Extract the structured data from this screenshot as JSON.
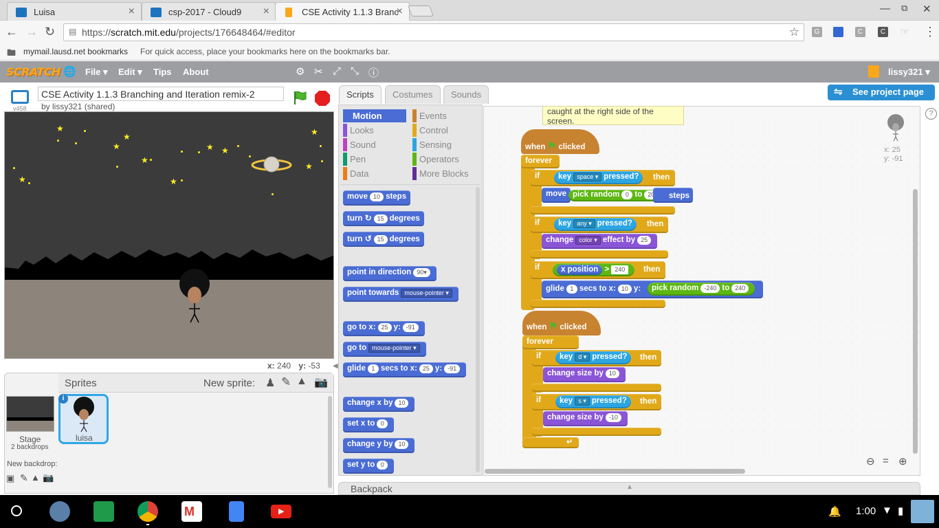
{
  "browser": {
    "tabs": [
      {
        "title": "Luisa",
        "close": "×"
      },
      {
        "title": "csp-2017 - Cloud9",
        "close": "×"
      },
      {
        "title": "CSE Activity 1.1.3 Branc",
        "close": "×"
      }
    ],
    "url_scheme": "https://",
    "url_host": "scratch.mit.edu",
    "url_path": "/projects/176648464/#editor",
    "bookmarks_folder": "mymail.lausd.net bookmarks",
    "bookmarks_hint": "For quick access, place your bookmarks here on the bookmarks bar.",
    "extensions": [
      "G",
      "C",
      "C"
    ]
  },
  "scratch_menu": {
    "logo": "SCRATCH",
    "file": "File ▾",
    "edit": "Edit ▾",
    "tips": "Tips",
    "about": "About",
    "user": "lissy321 ▾"
  },
  "project": {
    "title": "CSE Activity 1.1.3 Branching and Iteration remix-2",
    "byline": "by lissy321 (shared)",
    "version": "v458"
  },
  "stage": {
    "mouse_x_label": "x:",
    "mouse_x": "240",
    "mouse_y_label": "y:",
    "mouse_y": "-53"
  },
  "sprites": {
    "header": "Sprites",
    "new_sprite": "New sprite:",
    "stage_label": "Stage",
    "stage_backdrops": "2 backdrops",
    "new_backdrop": "New backdrop:",
    "sprite_name": "luisa",
    "info_icon": "i"
  },
  "editor_tabs": {
    "scripts": "Scripts",
    "costumes": "Costumes",
    "sounds": "Sounds"
  },
  "see_project": "See project page",
  "categories": [
    {
      "label": "Motion",
      "color": "#4a6cd4"
    },
    {
      "label": "Events",
      "color": "#c88330"
    },
    {
      "label": "Looks",
      "color": "#8a55d7"
    },
    {
      "label": "Control",
      "color": "#e1a91a"
    },
    {
      "label": "Sound",
      "color": "#bb42c3"
    },
    {
      "label": "Sensing",
      "color": "#2ca5e2"
    },
    {
      "label": "Pen",
      "color": "#0e9a6c"
    },
    {
      "label": "Operators",
      "color": "#5cb712"
    },
    {
      "label": "Data",
      "color": "#ee7d16"
    },
    {
      "label": "More Blocks",
      "color": "#632d99"
    }
  ],
  "palette": {
    "move": "move",
    "move_n": "10",
    "steps": "steps",
    "turn": "turn",
    "turn_cw_n": "15",
    "turn_ccw_n": "15",
    "degrees": "degrees",
    "point_in_direction": "point in direction",
    "dir_n": "90▾",
    "point_towards": "point towards",
    "mouse_pointer": "mouse-pointer",
    "go_to_x": "go to x:",
    "goto_x": "25",
    "y": "y:",
    "goto_y": "-91",
    "go_to": "go to",
    "glide": "glide",
    "glide_n": "1",
    "secs_to_x": "secs to x:",
    "glide_x": "25",
    "glide_y": "-91",
    "change_x_by": "change x by",
    "cx_n": "10",
    "set_x_to": "set x to",
    "sx_n": "0",
    "change_y_by": "change y by",
    "cy_n": "10",
    "set_y_to": "set y to",
    "sy_n": "0"
  },
  "comment_text": "caught at the right side of the screen.",
  "sprite_pos": {
    "x": "x: 25",
    "y": "y: -91"
  },
  "script1": {
    "when": "when",
    "clicked": "clicked",
    "forever": "forever",
    "if": "if",
    "then": "then",
    "key": "key",
    "space": "space",
    "any": "any",
    "pressed": "pressed?",
    "move": "move",
    "pick_random": "pick random",
    "to": "to",
    "steps": "steps",
    "r1_from": "0",
    "r1_to": "20",
    "change": "change",
    "color": "color",
    "effect_by": "effect by",
    "effect_n": "25",
    "x_position": "x position",
    "gt": ">",
    "gt_n": "240",
    "glide": "glide",
    "glide_n": "1",
    "secs_to_x": "secs to x:",
    "glide_x": "10",
    "y": "y:",
    "r2_from": "-240",
    "r2_to": "240"
  },
  "script2": {
    "when": "when",
    "clicked": "clicked",
    "forever": "forever",
    "if": "if",
    "then": "then",
    "key": "key",
    "d": "d",
    "s": "s",
    "pressed": "pressed?",
    "change_size_by": "change size by",
    "up_n": "10",
    "down_n": "-10"
  },
  "backpack": "Backpack",
  "taskbar": {
    "time": "1:00"
  }
}
